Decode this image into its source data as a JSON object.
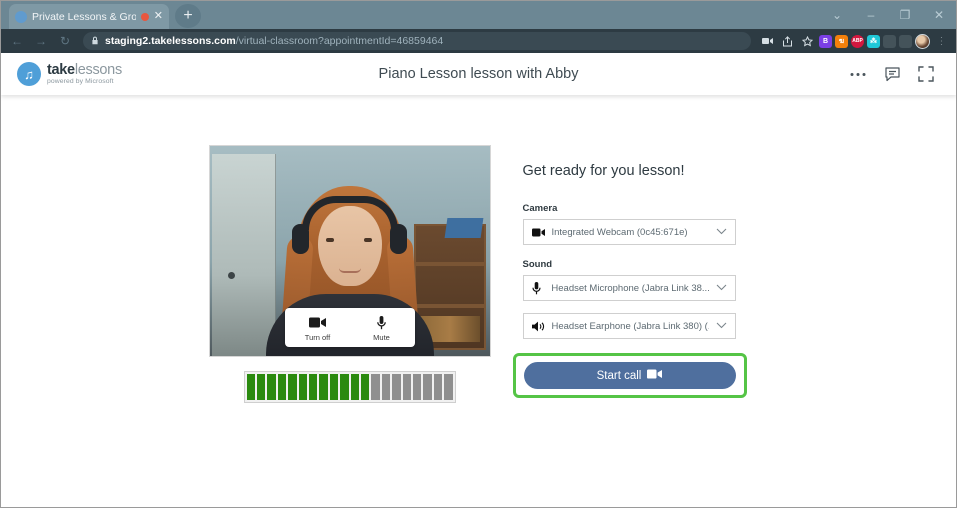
{
  "browser": {
    "tab": {
      "title": "Private Lessons & Group Cla",
      "favicon": "site-favicon",
      "recording_indicator": "recording-dot",
      "close_label": "✕"
    },
    "new_tab_label": "+",
    "window_controls": [
      {
        "name": "tab-search",
        "glyph": "⌄"
      },
      {
        "name": "minimize",
        "glyph": "–"
      },
      {
        "name": "maximize",
        "glyph": "❐"
      },
      {
        "name": "close",
        "glyph": "✕"
      }
    ],
    "nav": [
      {
        "name": "back",
        "glyph": "←"
      },
      {
        "name": "forward",
        "glyph": "→"
      },
      {
        "name": "reload",
        "glyph": "↻"
      }
    ],
    "omnibox": {
      "lock_glyph": "🔒",
      "host": "staging2.takelessons.com",
      "path": "/virtual-classroom?appointmentId=46859464"
    },
    "toolbar_icons": [
      {
        "name": "media-cast-icon",
        "glyph": "▬"
      },
      {
        "name": "share-icon",
        "glyph": "↪"
      },
      {
        "name": "bookmark-star-icon",
        "glyph": "☆"
      }
    ],
    "extensions": [
      {
        "name": "extension-bitwarden",
        "label": "B",
        "color": "#7b3fe4",
        "round": false,
        "faded": false
      },
      {
        "name": "extension-orange",
        "label": "ฆ",
        "color": "#f3800b",
        "round": false,
        "faded": false
      },
      {
        "name": "extension-adblock-plus",
        "label": "ABP",
        "color": "#d3173f",
        "round": true,
        "faded": false
      },
      {
        "name": "extension-cyan",
        "label": "⁂",
        "color": "#1fc8d8",
        "round": false,
        "faded": false
      },
      {
        "name": "extension-inactive-1",
        "label": "♜",
        "color": "#7b8a92",
        "round": false,
        "faded": true
      },
      {
        "name": "extension-inactive-2",
        "label": "▭",
        "color": "#7b8a92",
        "round": false,
        "faded": true
      }
    ],
    "profile_avatar": "profile-avatar",
    "overflow_menu": "⋮"
  },
  "app_header": {
    "brand": {
      "mark_glyph": "♫",
      "name_bold": "take",
      "name_light": "lessons",
      "tagline": "powered by Microsoft"
    },
    "title": "Piano Lesson lesson with Abby",
    "actions": [
      {
        "name": "more-options-icon",
        "glyph": "⋯"
      },
      {
        "name": "chat-icon",
        "glyph": "💬"
      },
      {
        "name": "fullscreen-icon",
        "glyph": "⛶"
      }
    ]
  },
  "video_preview": {
    "controls": [
      {
        "name": "toggle-camera-button",
        "icon": "video-camera-icon",
        "label": "Turn off"
      },
      {
        "name": "toggle-mic-button",
        "icon": "microphone-icon",
        "label": "Mute"
      }
    ],
    "audio_meter": {
      "total_segments": 20,
      "active_segments": 12,
      "active_color": "#2a8a0f",
      "inactive_color": "#8f8f8f"
    }
  },
  "setup_panel": {
    "heading": "Get ready for you lesson!",
    "camera": {
      "label": "Camera",
      "selected": "Integrated Webcam (0c45:671e)",
      "icon": "video-camera-icon",
      "caret": "⌄"
    },
    "sound": {
      "label": "Sound",
      "microphone": {
        "selected": "Headset Microphone (Jabra Link 38...",
        "icon": "microphone-icon",
        "caret": "⌄"
      },
      "speaker": {
        "selected": "Headset Earphone (Jabra Link 380) (...",
        "icon": "speaker-icon",
        "caret": "⌄"
      }
    },
    "start_call": {
      "label": "Start call",
      "icon": "video-camera-icon",
      "button_color": "#4f6f9e",
      "highlight_color": "#55c446"
    }
  }
}
